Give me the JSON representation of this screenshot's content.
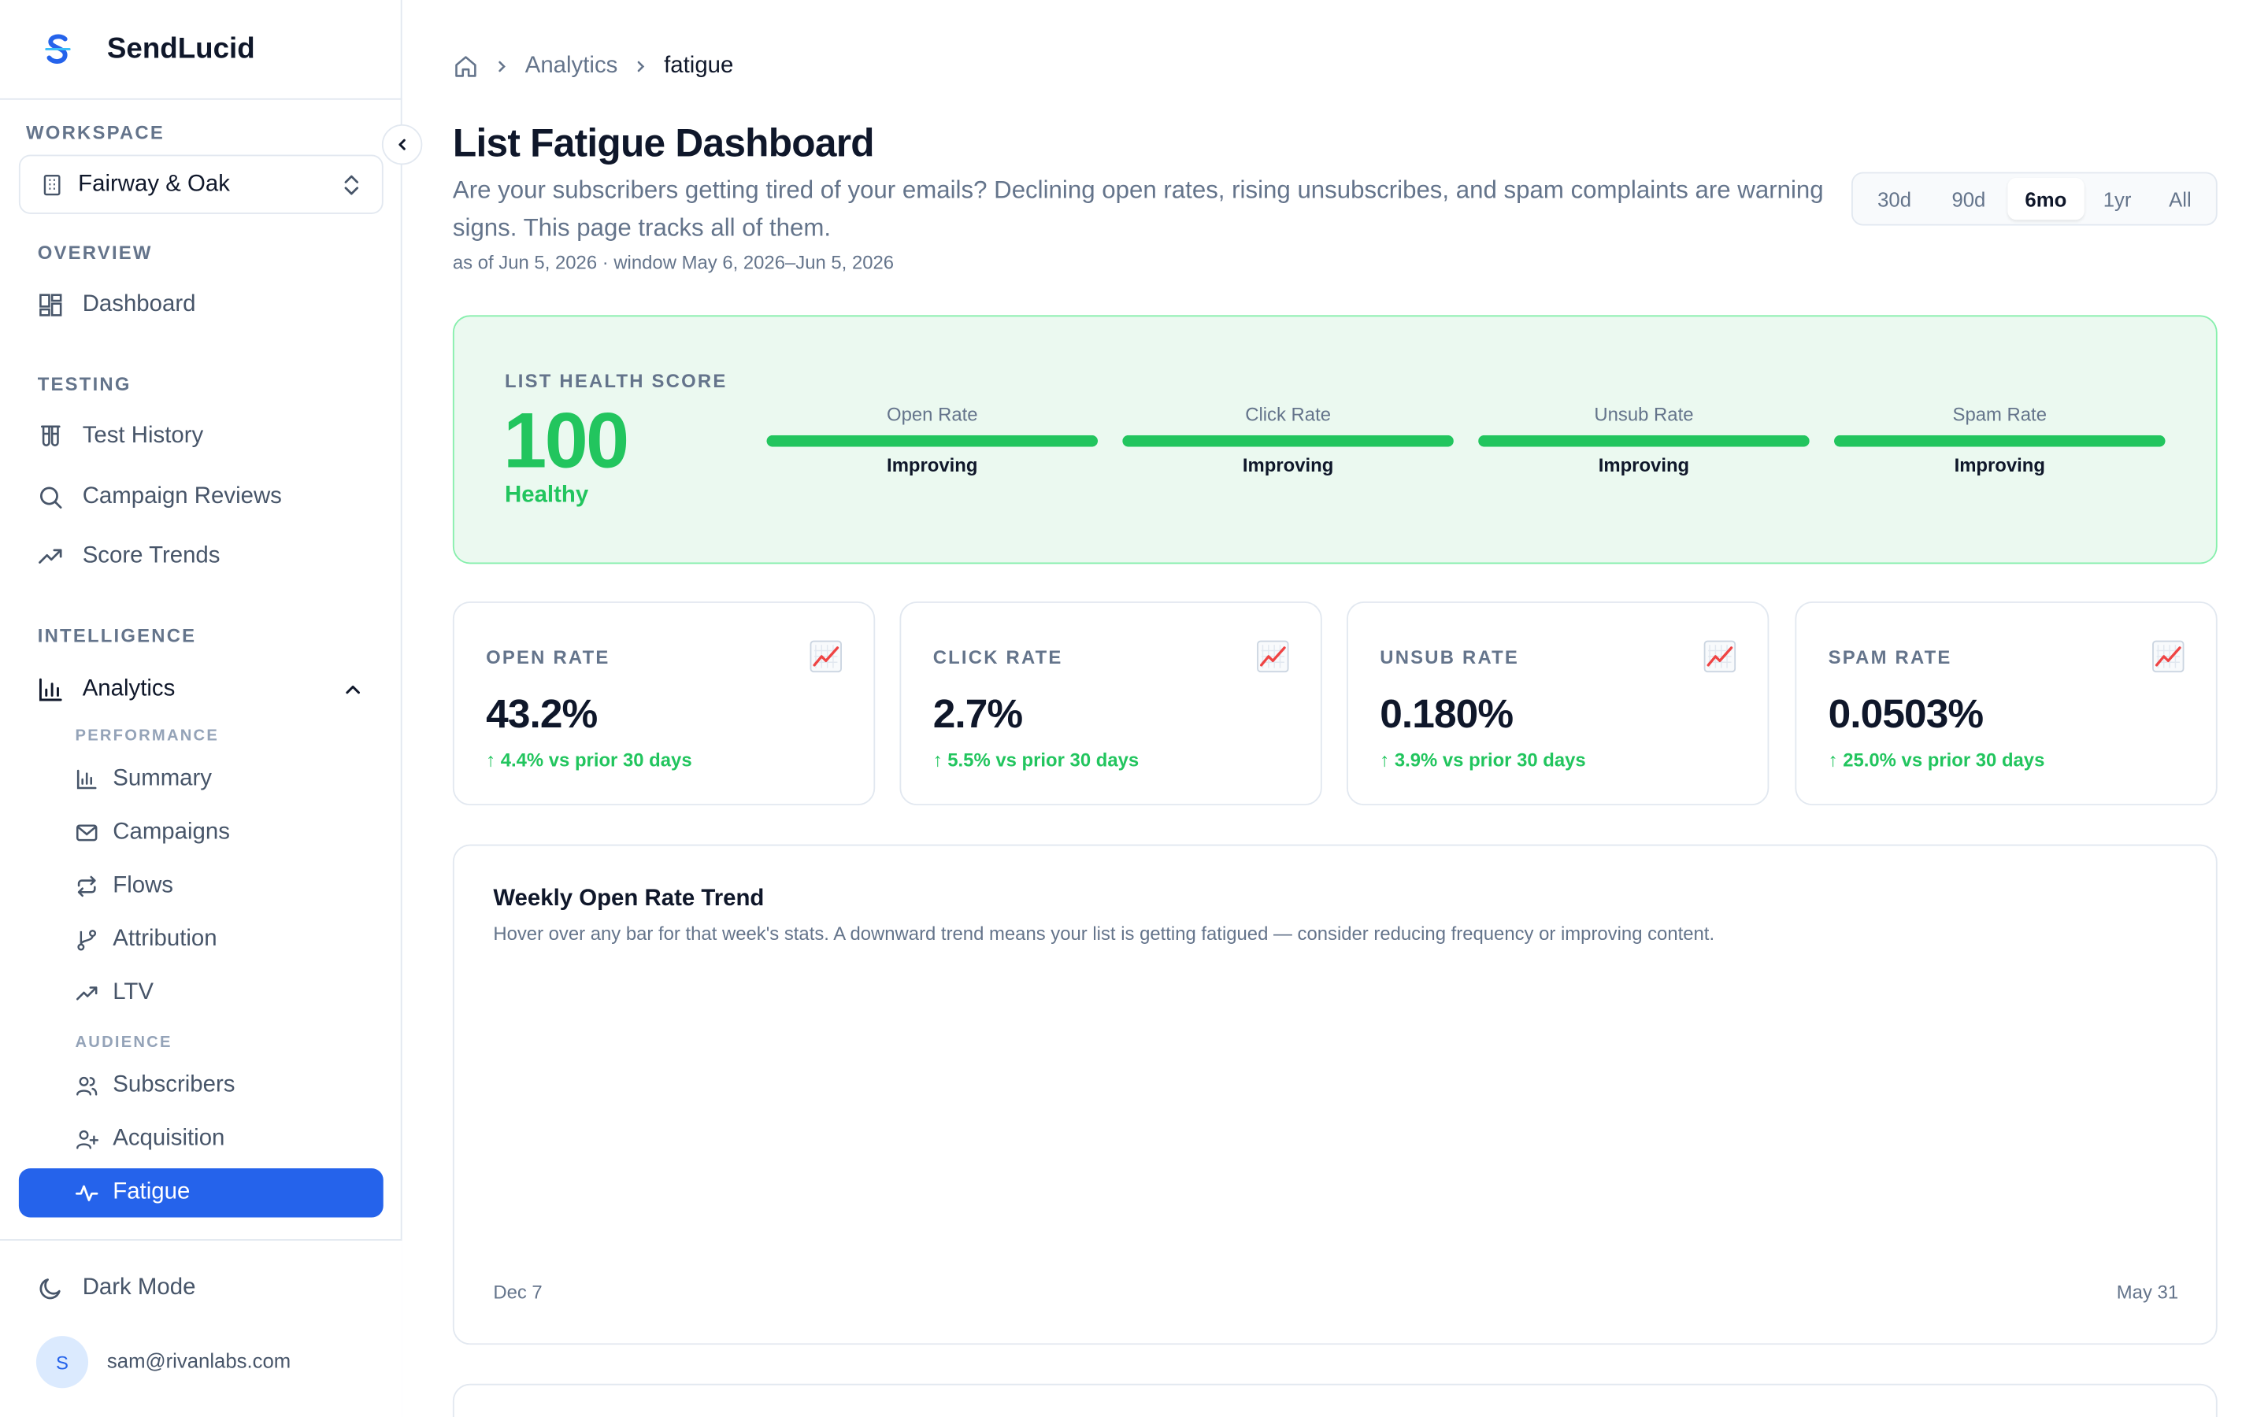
{
  "brand": {
    "name": "SendLucid"
  },
  "workspace": {
    "label": "WORKSPACE",
    "name": "Fairway & Oak"
  },
  "sidebar": {
    "overview_label": "OVERVIEW",
    "dashboard": "Dashboard",
    "testing_label": "TESTING",
    "test_history": "Test History",
    "campaign_reviews": "Campaign Reviews",
    "score_trends": "Score Trends",
    "intelligence_label": "INTELLIGENCE",
    "analytics": "Analytics",
    "performance_label": "PERFORMANCE",
    "summary": "Summary",
    "campaigns": "Campaigns",
    "flows": "Flows",
    "attribution": "Attribution",
    "ltv": "LTV",
    "audience_label": "AUDIENCE",
    "subscribers": "Subscribers",
    "acquisition": "Acquisition",
    "fatigue": "Fatigue",
    "dark_mode": "Dark Mode",
    "user_initial": "S",
    "user_email": "sam@rivanlabs.com"
  },
  "breadcrumb": {
    "section": "Analytics",
    "current": "fatigue"
  },
  "page": {
    "title": "List Fatigue Dashboard",
    "description": "Are your subscribers getting tired of your emails? Declining open rates, rising unsubscribes, and spam complaints are warning signs. This page tracks all of them.",
    "meta": "as of Jun 5, 2026 · window May 6, 2026–Jun 5, 2026"
  },
  "range": {
    "options": [
      "30d",
      "90d",
      "6mo",
      "1yr",
      "All"
    ],
    "selected": "6mo"
  },
  "health": {
    "label": "LIST HEALTH SCORE",
    "score": "100",
    "status": "Healthy",
    "metrics": [
      {
        "label": "Open Rate",
        "status": "Improving",
        "fill": 1.0
      },
      {
        "label": "Click Rate",
        "status": "Improving",
        "fill": 1.0
      },
      {
        "label": "Unsub Rate",
        "status": "Improving",
        "fill": 1.0
      },
      {
        "label": "Spam Rate",
        "status": "Improving",
        "fill": 1.0
      }
    ]
  },
  "kpis": [
    {
      "label": "OPEN RATE",
      "value": "43.2%",
      "delta": "↑ 4.4% vs prior 30 days",
      "icon": "chart-increasing-icon"
    },
    {
      "label": "CLICK RATE",
      "value": "2.7%",
      "delta": "↑ 5.5% vs prior 30 days",
      "icon": "chart-increasing-icon"
    },
    {
      "label": "UNSUB RATE",
      "value": "0.180%",
      "delta": "↑ 3.9% vs prior 30 days",
      "icon": "chart-increasing-icon"
    },
    {
      "label": "SPAM RATE",
      "value": "0.0503%",
      "delta": "↑ 25.0% vs prior 30 days",
      "icon": "chart-increasing-icon"
    }
  ],
  "trend": {
    "title": "Weekly Open Rate Trend",
    "subtitle": "Hover over any bar for that week's stats. A downward trend means your list is getting fatigued — consider reducing frequency or improving content.",
    "start_label": "Dec 7",
    "end_label": "May 31"
  },
  "colors": {
    "accent": "#2563eb",
    "healthy": "#22c55e",
    "health_bg": "#ebf9f0",
    "health_border": "#86efac"
  }
}
